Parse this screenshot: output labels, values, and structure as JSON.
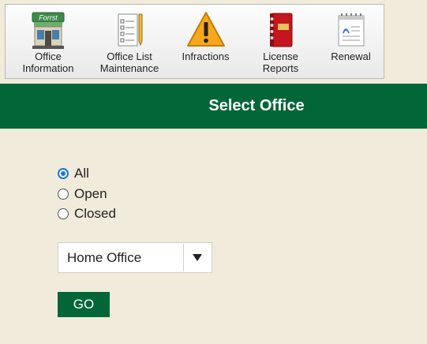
{
  "toolbar": {
    "items": [
      {
        "label_line1": "Office",
        "label_line2": "Information",
        "icon": "storefront-icon",
        "sign_text": "Forrst"
      },
      {
        "label_line1": "Office List",
        "label_line2": "Maintenance",
        "icon": "checklist-pencil-icon"
      },
      {
        "label_line1": "Infractions",
        "label_line2": "",
        "icon": "warning-icon"
      },
      {
        "label_line1": "License",
        "label_line2": "Reports",
        "icon": "red-binder-icon"
      },
      {
        "label_line1": "Renewal",
        "label_line2": "",
        "icon": "calendar-note-icon"
      }
    ]
  },
  "header": {
    "title": "Select Office",
    "color": "#036638"
  },
  "filter": {
    "options": [
      {
        "label": "All",
        "checked": true
      },
      {
        "label": "Open",
        "checked": false
      },
      {
        "label": "Closed",
        "checked": false
      }
    ]
  },
  "office_select": {
    "value": "Home Office",
    "arrow": "▼"
  },
  "go_button": {
    "label": "GO"
  },
  "colors": {
    "background": "#f1ebdb",
    "brand_green": "#036638",
    "radio_accent": "#1a73e8"
  }
}
